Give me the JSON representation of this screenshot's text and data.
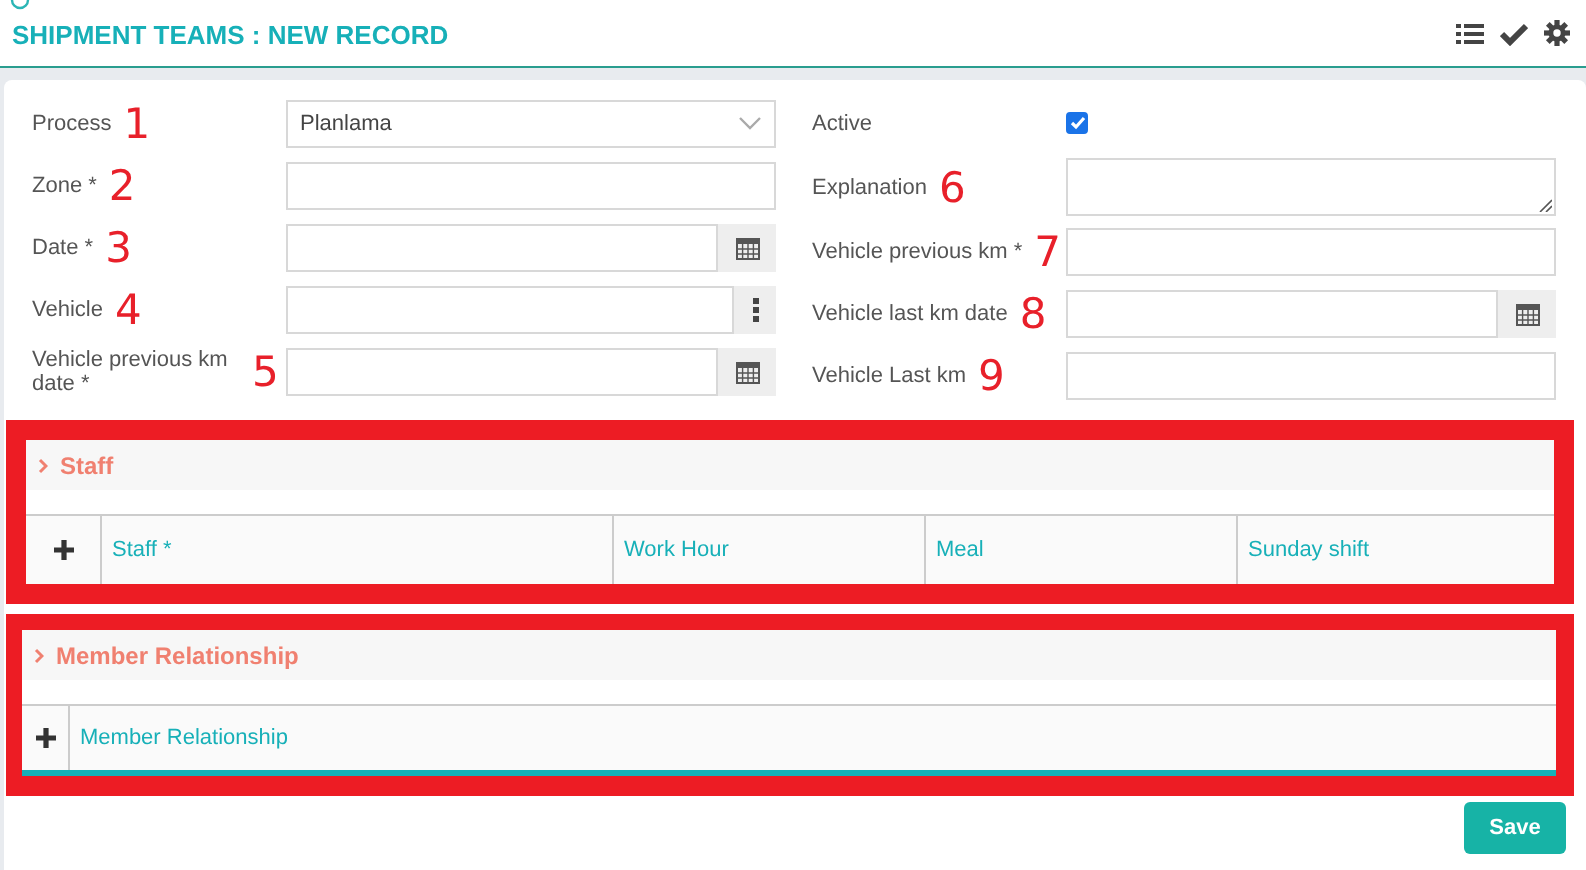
{
  "title": "SHIPMENT TEAMS : NEW RECORD",
  "left_fields": [
    {
      "label": "Process",
      "annotation": "1",
      "kind": "select",
      "value": "Planlama"
    },
    {
      "label": "Zone *",
      "annotation": "2",
      "kind": "text"
    },
    {
      "label": "Date *",
      "annotation": "3",
      "kind": "date"
    },
    {
      "label": "Vehicle",
      "annotation": "4",
      "kind": "lookup"
    },
    {
      "label": "Vehicle previous km date *",
      "annotation": "5",
      "kind": "date"
    }
  ],
  "right_fields": [
    {
      "label": "Active",
      "kind": "checkbox",
      "checked": true
    },
    {
      "label": "Explanation",
      "annotation": "6",
      "kind": "textarea"
    },
    {
      "label": "Vehicle previous km *",
      "annotation": "7",
      "kind": "text"
    },
    {
      "label": "Vehicle last km date",
      "annotation": "8",
      "kind": "date"
    },
    {
      "label": "Vehicle Last km",
      "annotation": "9",
      "kind": "text"
    }
  ],
  "sections": [
    {
      "title": "Staff",
      "columns": [
        "Staff *",
        "Work Hour",
        "Meal",
        "Sunday shift"
      ]
    },
    {
      "title": "Member Relationship",
      "columns": [
        "Member Relationship"
      ]
    }
  ],
  "save_button": "Save"
}
